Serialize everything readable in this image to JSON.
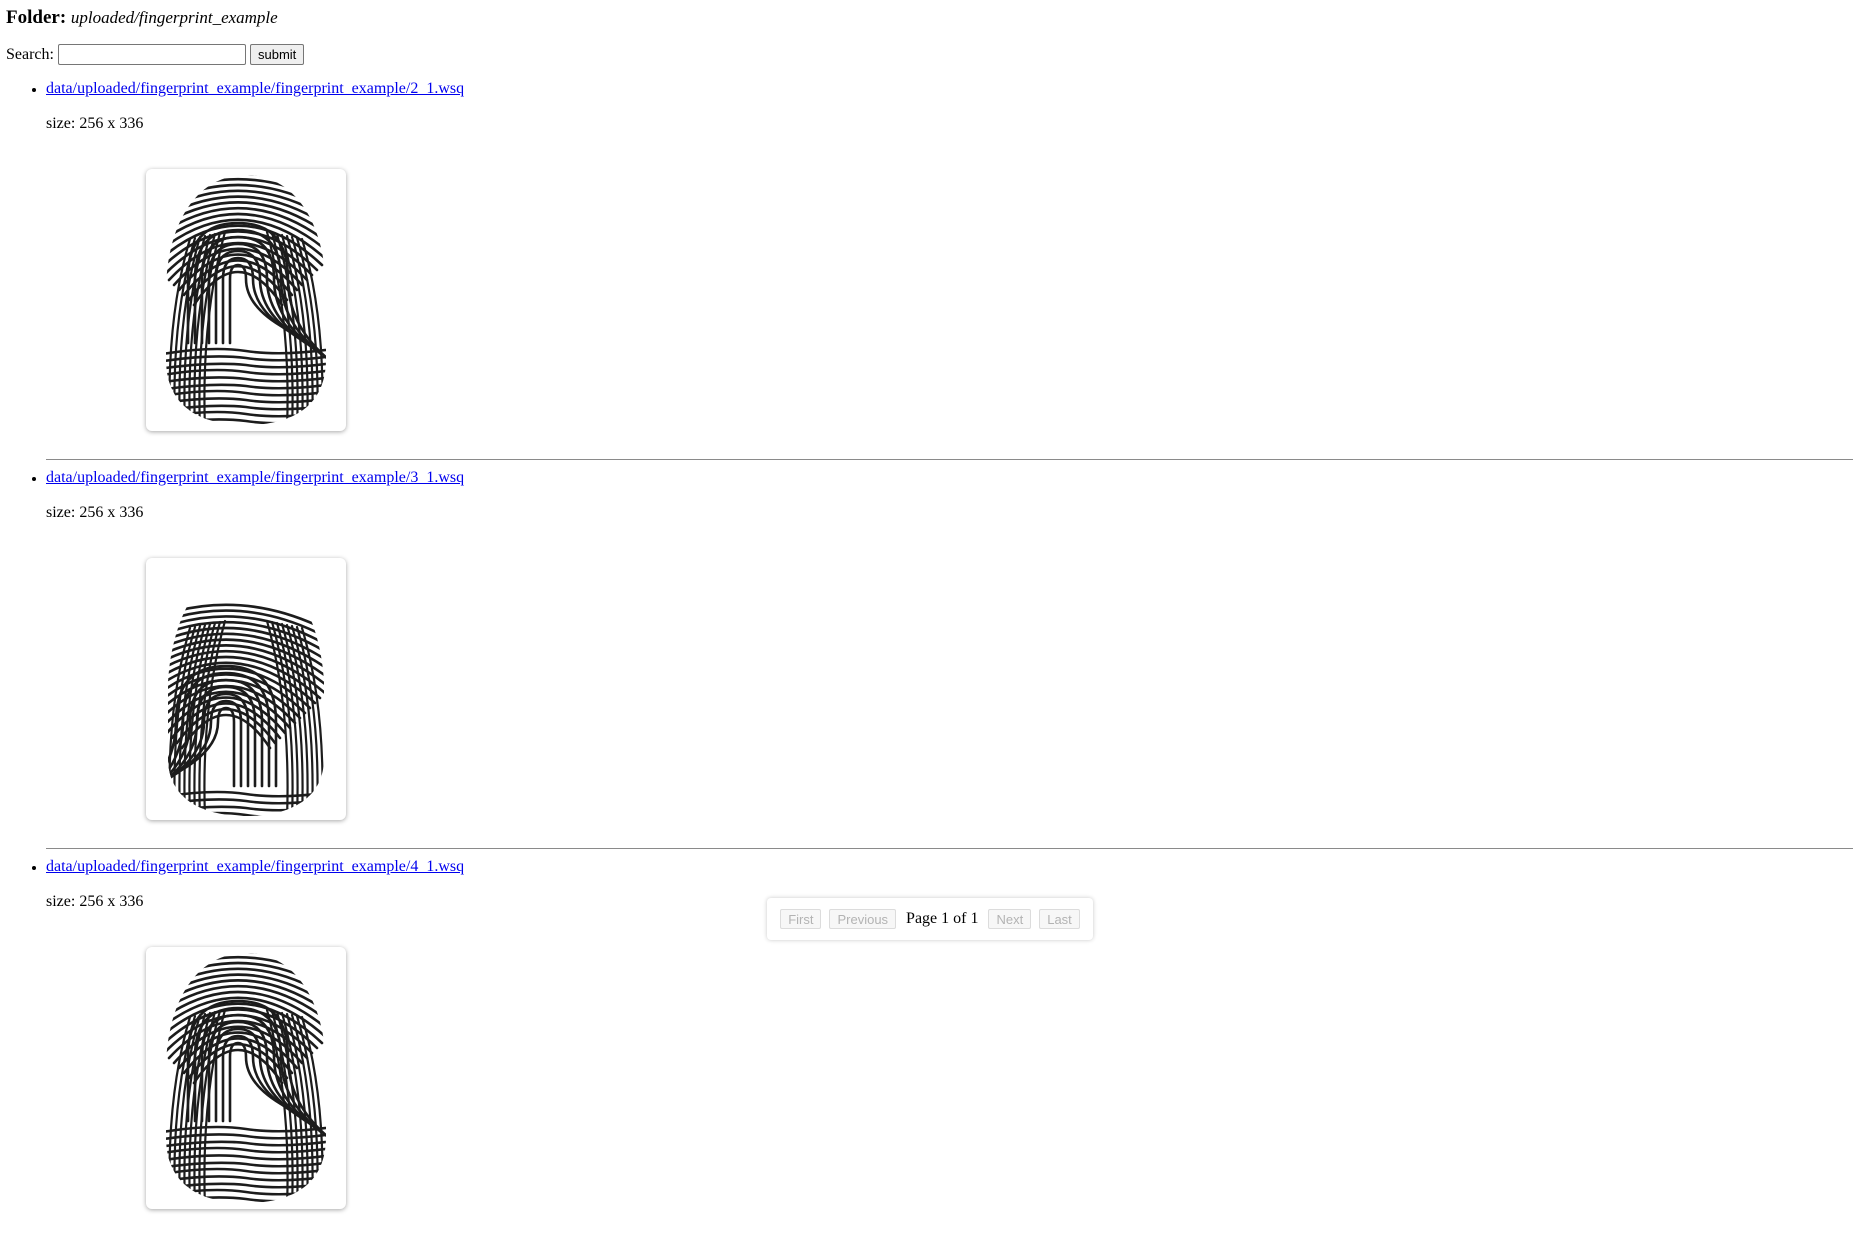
{
  "header": {
    "folder_label": "Folder:",
    "folder_path": "uploaded/fingerprint_example"
  },
  "search": {
    "label": "Search:",
    "value": "",
    "placeholder": "",
    "submit_label": "submit"
  },
  "files": [
    {
      "link": "data/uploaded/fingerprint_example/fingerprint_example/2_1.wsq",
      "size": "size: 256 x 336",
      "image_name": "fingerprint-image"
    },
    {
      "link": "data/uploaded/fingerprint_example/fingerprint_example/3_1.wsq",
      "size": "size: 256 x 336",
      "image_name": "fingerprint-image"
    },
    {
      "link": "data/uploaded/fingerprint_example/fingerprint_example/4_1.wsq",
      "size": "size: 256 x 336",
      "image_name": "fingerprint-image"
    }
  ],
  "pagination": {
    "first_label": "First",
    "previous_label": "Previous",
    "status": "Page 1 of 1",
    "next_label": "Next",
    "last_label": "Last"
  },
  "colors": {
    "link": "#0000ee",
    "disabled_text": "#b3b3b3"
  }
}
